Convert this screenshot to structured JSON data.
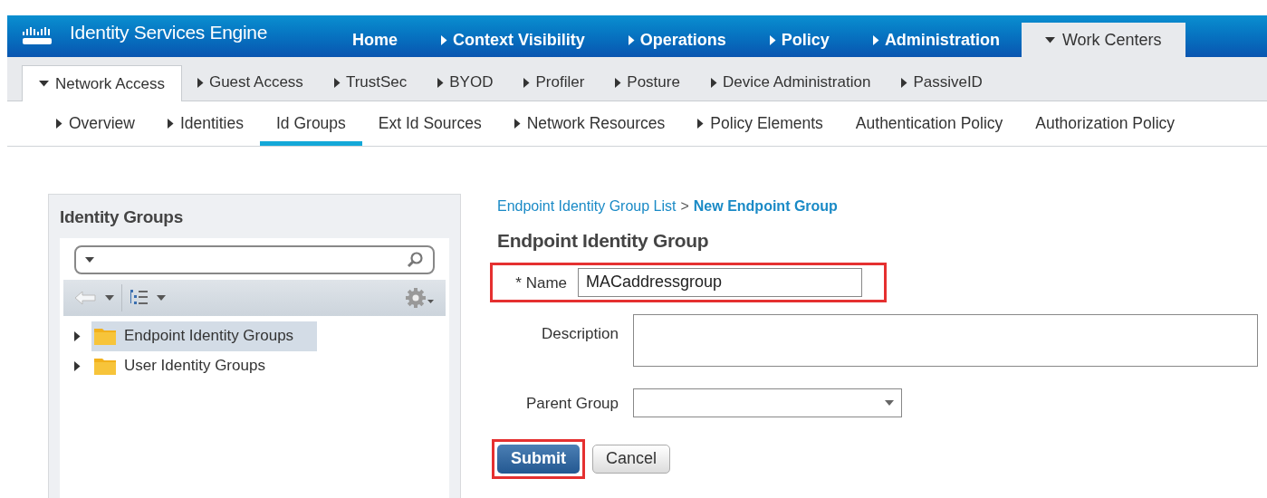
{
  "header": {
    "title": "Identity Services Engine"
  },
  "top_nav": [
    {
      "label": "Home",
      "kind": "link",
      "selected": false
    },
    {
      "label": "Context Visibility",
      "kind": "menu",
      "expanded": false,
      "selected": false
    },
    {
      "label": "Operations",
      "kind": "menu",
      "expanded": false,
      "selected": false
    },
    {
      "label": "Policy",
      "kind": "menu",
      "expanded": false,
      "selected": false
    },
    {
      "label": "Administration",
      "kind": "menu",
      "expanded": false,
      "selected": false
    },
    {
      "label": "Work Centers",
      "kind": "menu",
      "expanded": true,
      "selected": true
    }
  ],
  "section_tabs": [
    {
      "label": "Network Access",
      "kind": "menu",
      "expanded": true,
      "selected": true
    },
    {
      "label": "Guest Access",
      "kind": "menu",
      "expanded": false,
      "selected": false
    },
    {
      "label": "TrustSec",
      "kind": "menu",
      "expanded": false,
      "selected": false
    },
    {
      "label": "BYOD",
      "kind": "menu",
      "expanded": false,
      "selected": false
    },
    {
      "label": "Profiler",
      "kind": "menu",
      "expanded": false,
      "selected": false
    },
    {
      "label": "Posture",
      "kind": "menu",
      "expanded": false,
      "selected": false
    },
    {
      "label": "Device Administration",
      "kind": "menu",
      "expanded": false,
      "selected": false
    },
    {
      "label": "PassiveID",
      "kind": "menu",
      "expanded": false,
      "selected": false
    }
  ],
  "sub_tabs": [
    {
      "label": "Overview",
      "kind": "menu",
      "selected": false
    },
    {
      "label": "Identities",
      "kind": "menu",
      "selected": false
    },
    {
      "label": "Id Groups",
      "kind": "link",
      "selected": true
    },
    {
      "label": "Ext Id Sources",
      "kind": "link",
      "selected": false
    },
    {
      "label": "Network Resources",
      "kind": "menu",
      "selected": false
    },
    {
      "label": "Policy Elements",
      "kind": "menu",
      "selected": false
    },
    {
      "label": "Authentication Policy",
      "kind": "link",
      "selected": false
    },
    {
      "label": "Authorization Policy",
      "kind": "link",
      "selected": false
    }
  ],
  "sidebar": {
    "title": "Identity Groups",
    "items": [
      {
        "label": "Endpoint Identity Groups",
        "expanded": false,
        "selected": true
      },
      {
        "label": "User Identity Groups",
        "expanded": false,
        "selected": false
      }
    ]
  },
  "form": {
    "breadcrumb": [
      {
        "label": "Endpoint Identity Group List",
        "current": false
      },
      {
        "label": "New Endpoint Group",
        "current": true
      }
    ],
    "breadcrumb_separator": ">",
    "title": "Endpoint Identity Group",
    "fields": [
      {
        "label": "* Name",
        "kind": "text",
        "value": "MACaddressgroup",
        "highlighted": true
      },
      {
        "label": "Description",
        "kind": "textarea",
        "highlighted": false
      },
      {
        "label": "Parent Group",
        "kind": "select",
        "highlighted": false
      }
    ],
    "buttons": [
      {
        "label": "Submit",
        "kind": "primary",
        "highlighted": true
      },
      {
        "label": "Cancel",
        "kind": "secondary",
        "highlighted": false
      }
    ]
  }
}
